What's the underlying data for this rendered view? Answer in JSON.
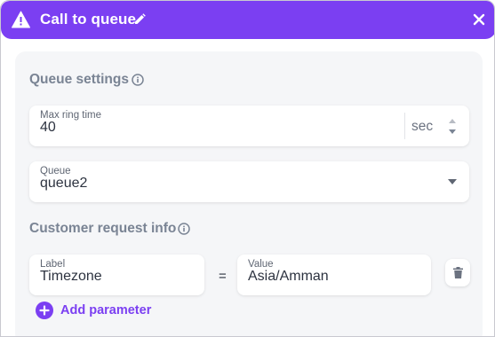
{
  "header": {
    "title": "Call to queue",
    "accent_color": "#7b3ff2",
    "warning_icon": "warning-triangle-icon",
    "edit_icon": "pencil-icon",
    "close_icon": "close-icon"
  },
  "queue_settings": {
    "title": "Queue settings",
    "info_icon": "info-circle-icon",
    "max_ring_time": {
      "label": "Max ring time",
      "value": "40",
      "unit": "sec"
    },
    "queue": {
      "label": "Queue",
      "value": "queue2",
      "icon": "caret-down-icon"
    }
  },
  "customer_request_info": {
    "title": "Customer request info",
    "info_icon": "info-circle-icon",
    "params": [
      {
        "label_caption": "Label",
        "label_value": "Timezone",
        "separator": "=",
        "value_caption": "Value",
        "value": "Asia/Amman",
        "delete_icon": "trash-icon"
      }
    ],
    "add_label": "Add parameter",
    "add_icon": "plus-circle-icon"
  }
}
